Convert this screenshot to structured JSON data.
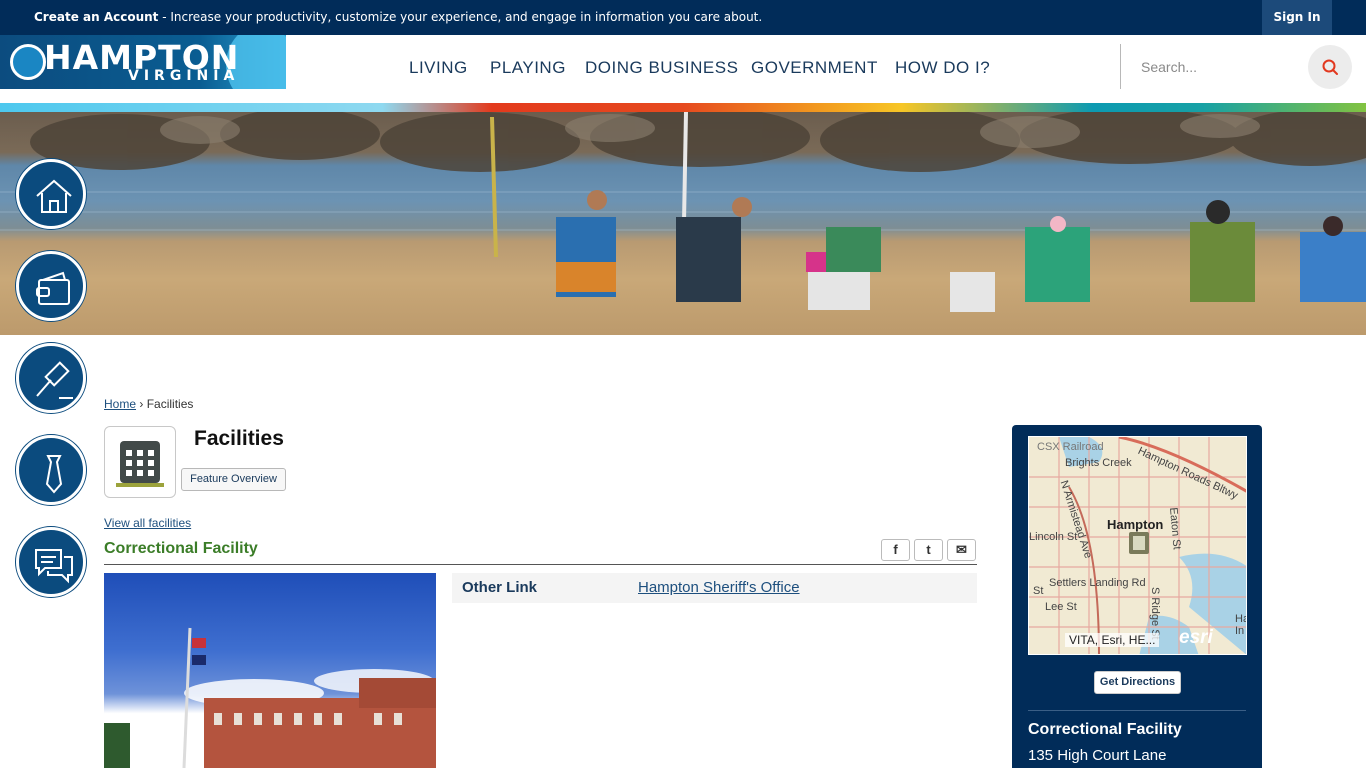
{
  "topbar": {
    "create_account": "Create an Account",
    "create_message": " - Increase your productivity, customize your experience, and engage in information you care about.",
    "sign_in": "Sign In"
  },
  "logo": {
    "name": "HAMPTON",
    "sub": "VIRGINIA"
  },
  "nav": {
    "items": [
      "LIVING",
      "PLAYING",
      "DOING BUSINESS",
      "GOVERNMENT",
      "HOW DO I?"
    ]
  },
  "search": {
    "placeholder": "Search..."
  },
  "quick_links": [
    "home-icon",
    "wallet-icon",
    "gavel-icon",
    "tie-icon",
    "chat-icon"
  ],
  "breadcrumb": {
    "home": "Home",
    "separator": "›",
    "current": "Facilities"
  },
  "page": {
    "title": "Facilities",
    "feature_overview": "Feature Overview",
    "view_all": "View all facilities",
    "section_title": "Correctional Facility"
  },
  "share": {
    "facebook": "f",
    "twitter": "t",
    "email": "✉"
  },
  "info": {
    "label": "Other Link",
    "link": "Hampton Sheriff's Office"
  },
  "map": {
    "labels": {
      "railroad": "CSX Railroad",
      "creek": "Brights Creek",
      "beltway": "Hampton Roads Bltwy",
      "armistead": "N Armistead Ave",
      "eaton": "Eaton St",
      "city": "Hampton",
      "lincoln": "Lincoln St",
      "settlers": "Settlers Landing Rd",
      "st": "St",
      "lee": "Lee St",
      "ridge": "S Ridge St",
      "ha": "Ha",
      "ha2": "In"
    },
    "credit": "VITA, Esri, HE...",
    "esri": "esri"
  },
  "sidebar": {
    "directions": "Get Directions",
    "name": "Correctional Facility",
    "address": "135 High Court Lane"
  },
  "colors": {
    "navy": "#012c59",
    "green": "#3b7d28",
    "accent_red": "#e33a1d"
  }
}
